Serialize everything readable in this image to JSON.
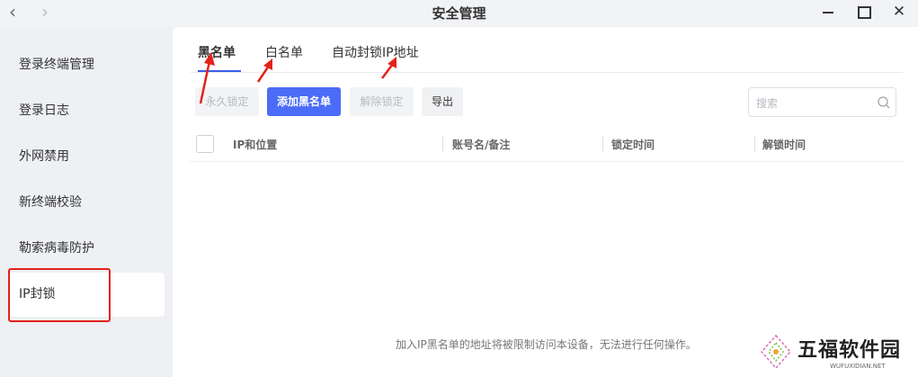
{
  "window": {
    "title": "安全管理"
  },
  "sidebar": {
    "items": [
      {
        "label": "登录终端管理"
      },
      {
        "label": "登录日志"
      },
      {
        "label": "外网禁用"
      },
      {
        "label": "新终端校验"
      },
      {
        "label": "勒索病毒防护"
      },
      {
        "label": "IP封锁",
        "active": true
      }
    ]
  },
  "tabs": [
    {
      "label": "黑名单",
      "active": true
    },
    {
      "label": "白名单"
    },
    {
      "label": "自动封锁IP地址"
    }
  ],
  "toolbar": {
    "permanent_lock": "永久锁定",
    "add_blacklist": "添加黑名单",
    "unlock": "解除锁定",
    "export": "导出",
    "search_placeholder": "搜索"
  },
  "table": {
    "columns": [
      "IP和位置",
      "账号名/备注",
      "锁定时间",
      "解锁时间"
    ]
  },
  "note": "加入IP黑名单的地址将被限制访问本设备，无法进行任何操作。",
  "watermark": {
    "name": "五福软件园",
    "domain": "WUFUXIDIAN.NET"
  },
  "colors": {
    "accent": "#4a6cf7",
    "annotation": "#e3231b"
  }
}
